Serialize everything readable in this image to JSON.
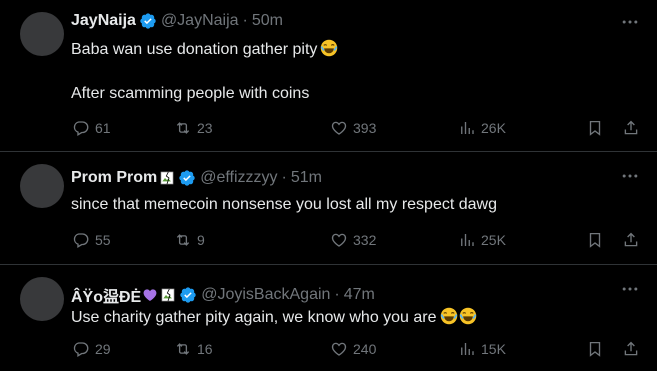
{
  "tweets": [
    {
      "name": "JayNaija",
      "handle": "@JayNaija",
      "separator": "·",
      "time": "50m",
      "lines": [
        "Baba wan use donation gather pity",
        "After scamming people with coins"
      ],
      "replies": "61",
      "retweets": "23",
      "likes": "393",
      "views": "26K"
    },
    {
      "name": "Prom Prom",
      "handle": "@effizzzyy",
      "separator": "·",
      "time": "51m",
      "lines": [
        "since that memecoin nonsense you lost all my respect dawg"
      ],
      "replies": "55",
      "retweets": "9",
      "likes": "332",
      "views": "25K"
    },
    {
      "name": "ÂŸo",
      "name_rest": "䀀ĐĖ",
      "handle": "@JoyisBackAgain",
      "separator": "·",
      "time": "47m",
      "lines": [
        "Use charity gather pity again, we know who you are"
      ],
      "replies": "29",
      "retweets": "16",
      "likes": "240",
      "views": "15K"
    }
  ],
  "colors": {
    "background": "#000000",
    "text": "#e7e9ea",
    "muted": "#71767b",
    "verified": "#1d9bf0",
    "divider": "#2f3336",
    "avatar": "#38393b"
  },
  "icons": [
    "verified-icon",
    "more-icon",
    "reply-icon",
    "retweet-icon",
    "like-icon",
    "views-icon",
    "bookmark-icon",
    "share-icon",
    "joy-emoji-icon",
    "purple-heart-icon",
    "broken-image-icon"
  ]
}
